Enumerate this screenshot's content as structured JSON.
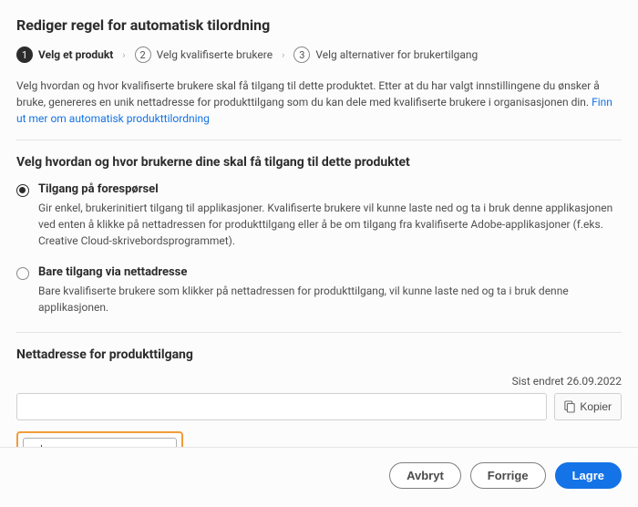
{
  "header": {
    "title": "Rediger regel for automatisk tilordning"
  },
  "steps": {
    "s1": {
      "num": "1",
      "label": "Velg et produkt"
    },
    "s2": {
      "num": "2",
      "label": "Velg kvalifiserte brukere"
    },
    "s3": {
      "num": "3",
      "label": "Velg alternativer for brukertilgang"
    }
  },
  "intro": {
    "text": "Velg hvordan og hvor kvalifiserte brukere skal få tilgang til dette produktet. Etter at du har valgt innstillingene du ønsker å bruke, genereres en unik nettadresse for produkttilgang som du kan dele med kvalifiserte brukere i organisasjonen din.  ",
    "link": "Finn ut mer om automatisk produkttilordning"
  },
  "access": {
    "heading": "Velg hvordan og hvor brukerne dine skal få tilgang til dette produktet",
    "opt1": {
      "title": "Tilgang på forespørsel",
      "desc": "Gir enkel, brukerinitiert tilgang til applikasjoner. Kvalifiserte brukere vil kunne laste ned og ta i bruk denne applikasjonen ved enten å klikke på nettadressen for produkttilgang eller å be om tilgang fra kvalifiserte Adobe-applikasjoner (f.eks. Creative Cloud-skrivebordsprogrammet)."
    },
    "opt2": {
      "title": "Bare tilgang via nettadresse",
      "desc": "Bare kvalifiserte brukere som klikker på nettadressen for produkttilgang, vil kunne laste ned og ta i bruk denne applikasjonen."
    }
  },
  "url": {
    "heading": "Nettadresse for produkttilgang",
    "lastModified": "Sist endret 26.09.2022",
    "value": "",
    "copy": "Kopier",
    "create": "Opprett ny nettadresse"
  },
  "footer": {
    "cancel": "Avbryt",
    "previous": "Forrige",
    "save": "Lagre"
  }
}
